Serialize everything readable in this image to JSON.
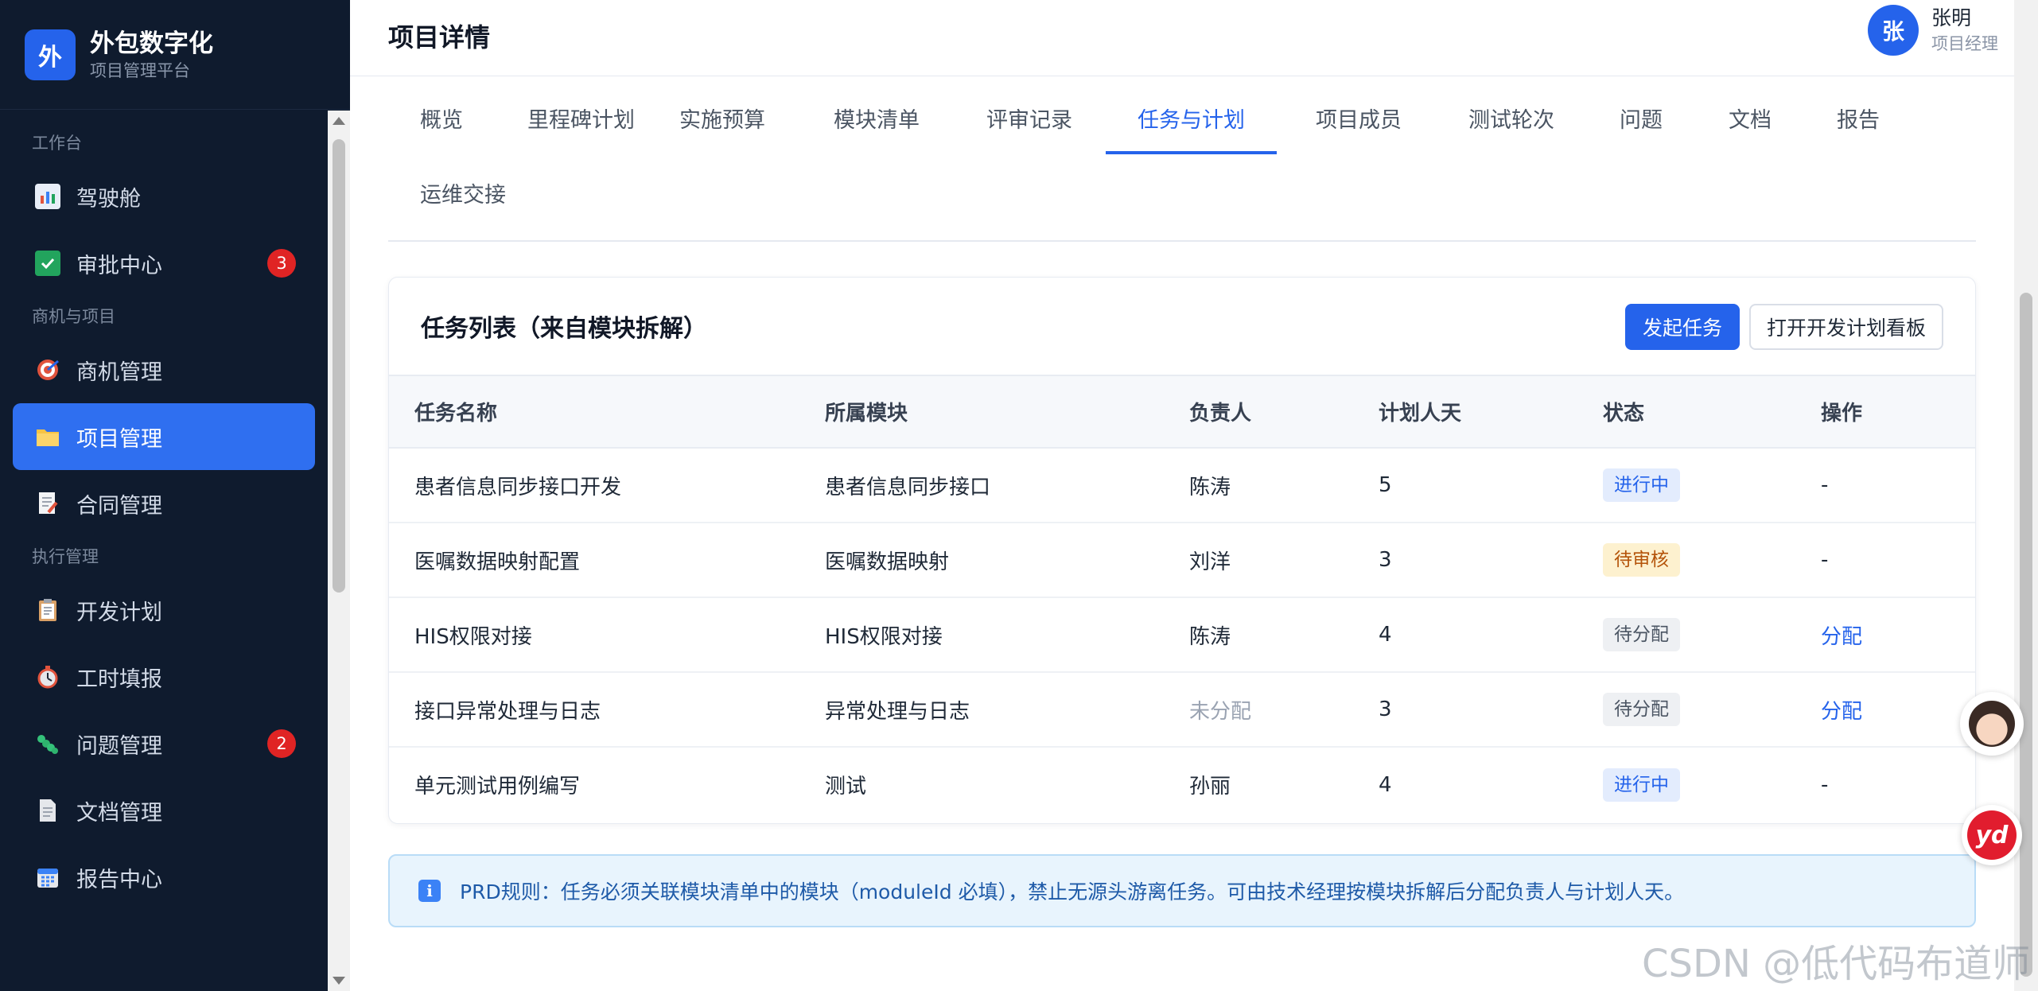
{
  "brand": {
    "logo": "外",
    "title": "外包数字化",
    "subtitle": "项目管理平台"
  },
  "sidebar": {
    "groups": [
      {
        "label": "工作台"
      },
      {
        "label": "商机与项目"
      },
      {
        "label": "执行管理"
      }
    ],
    "items": [
      {
        "label": "驾驶舱",
        "icon": "dashboard-icon"
      },
      {
        "label": "审批中心",
        "icon": "check-icon",
        "badge": "3"
      },
      {
        "label": "商机管理",
        "icon": "target-icon"
      },
      {
        "label": "项目管理",
        "icon": "folder-icon",
        "active": true
      },
      {
        "label": "合同管理",
        "icon": "contract-icon"
      },
      {
        "label": "开发计划",
        "icon": "clipboard-icon"
      },
      {
        "label": "工时填报",
        "icon": "timer-icon"
      },
      {
        "label": "问题管理",
        "icon": "bug-icon",
        "badge": "2"
      },
      {
        "label": "文档管理",
        "icon": "document-icon"
      },
      {
        "label": "报告中心",
        "icon": "calendar-icon"
      }
    ]
  },
  "header": {
    "title": "项目详情"
  },
  "user": {
    "avatar": "张",
    "name": "张明",
    "role": "项目经理"
  },
  "tabs": [
    "概览",
    "里程碑计划",
    "实施预算",
    "模块清单",
    "评审记录",
    "任务与计划",
    "项目成员",
    "测试轮次",
    "问题",
    "文档",
    "报告",
    "运维交接"
  ],
  "active_tab": "任务与计划",
  "task_card": {
    "title": "任务列表（来自模块拆解）",
    "primary_button": "发起任务",
    "secondary_button": "打开开发计划看板",
    "columns": [
      "任务名称",
      "所属模块",
      "负责人",
      "计划人天",
      "状态",
      "操作"
    ],
    "rows": [
      {
        "name": "患者信息同步接口开发",
        "module": "患者信息同步接口",
        "owner": "陈涛",
        "days": "5",
        "status": "进行中",
        "action": "-"
      },
      {
        "name": "医嘱数据映射配置",
        "module": "医嘱数据映射",
        "owner": "刘洋",
        "days": "3",
        "status": "待审核",
        "action": "-"
      },
      {
        "name": "HIS权限对接",
        "module": "HIS权限对接",
        "owner": "陈涛",
        "days": "4",
        "status": "待分配",
        "action": "分配"
      },
      {
        "name": "接口异常处理与日志",
        "module": "异常处理与日志",
        "owner": "未分配",
        "days": "3",
        "status": "待分配",
        "action": "分配"
      },
      {
        "name": "单元测试用例编写",
        "module": "测试",
        "owner": "孙丽",
        "days": "4",
        "status": "进行中",
        "action": "-"
      }
    ]
  },
  "notice": {
    "icon": "info-icon",
    "text": "PRD规则：任务必须关联模块清单中的模块（moduleId 必填），禁止无源头游离任务。可由技术经理按模块拆解后分配负责人与计划人天。"
  },
  "floating": {
    "yd_label": "yd"
  },
  "watermark": "CSDN @低代码布道师",
  "colors": {
    "accent": "#2563eb",
    "sidebar_bg": "#0f1b2e",
    "badge": "#e02424"
  }
}
